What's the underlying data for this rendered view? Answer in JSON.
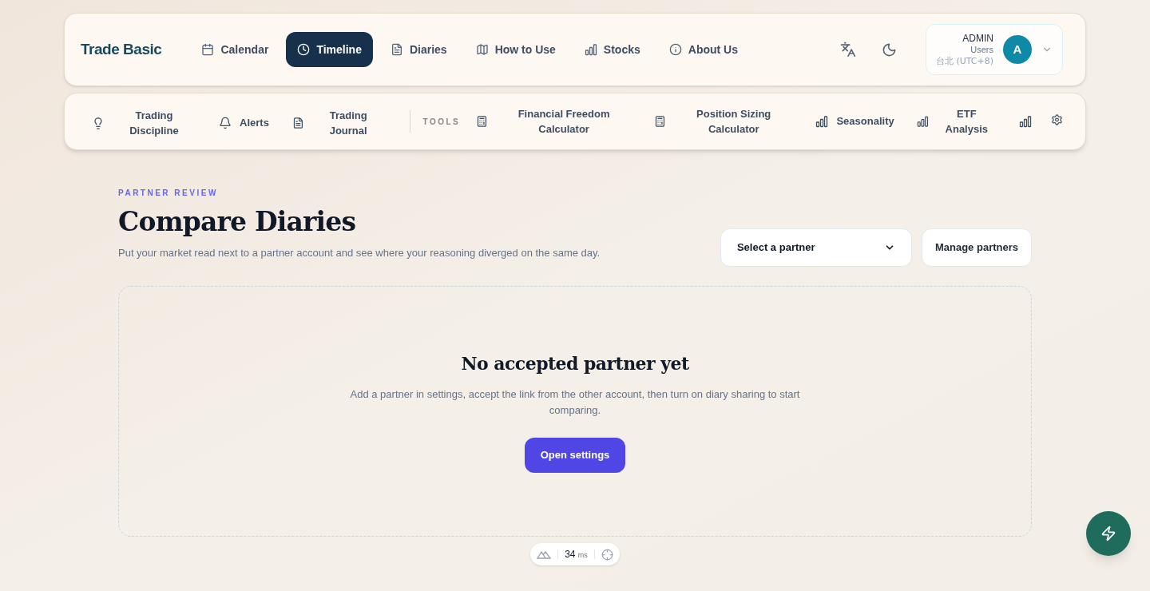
{
  "brand": "Trade Basic",
  "nav": [
    {
      "label": "Calendar",
      "selected": false
    },
    {
      "label": "Timeline",
      "selected": true
    },
    {
      "label": "Diaries",
      "selected": false
    },
    {
      "label": "How to Use",
      "selected": false
    },
    {
      "label": "Stocks",
      "selected": false
    },
    {
      "label": "About Us",
      "selected": false
    }
  ],
  "user": {
    "name": "ADMIN",
    "role": "Users",
    "timezone": "台北 (UTC+8)",
    "avatar": "A"
  },
  "subnav": [
    {
      "label": "Trading Discipline"
    },
    {
      "label": "Alerts"
    },
    {
      "label": "Trading Journal"
    }
  ],
  "tools_label": "TOOLS",
  "tools": [
    {
      "label": "Financial Freedom Calculator"
    },
    {
      "label": "Position Sizing Calculator"
    },
    {
      "label": "Seasonality"
    },
    {
      "label": "ETF Analysis"
    }
  ],
  "page": {
    "eyebrow": "PARTNER REVIEW",
    "title": "Compare Diaries",
    "subtitle": "Put your market read next to a partner account and see where your reasoning diverged on the same day.",
    "partner_select": "Select a partner",
    "manage_button": "Manage partners"
  },
  "empty": {
    "title": "No accepted partner yet",
    "text": "Add a partner in settings, accept the link from the other account, then turn on diary sharing to start comparing.",
    "button": "Open settings"
  },
  "status": {
    "value": "34",
    "unit": "ms"
  }
}
